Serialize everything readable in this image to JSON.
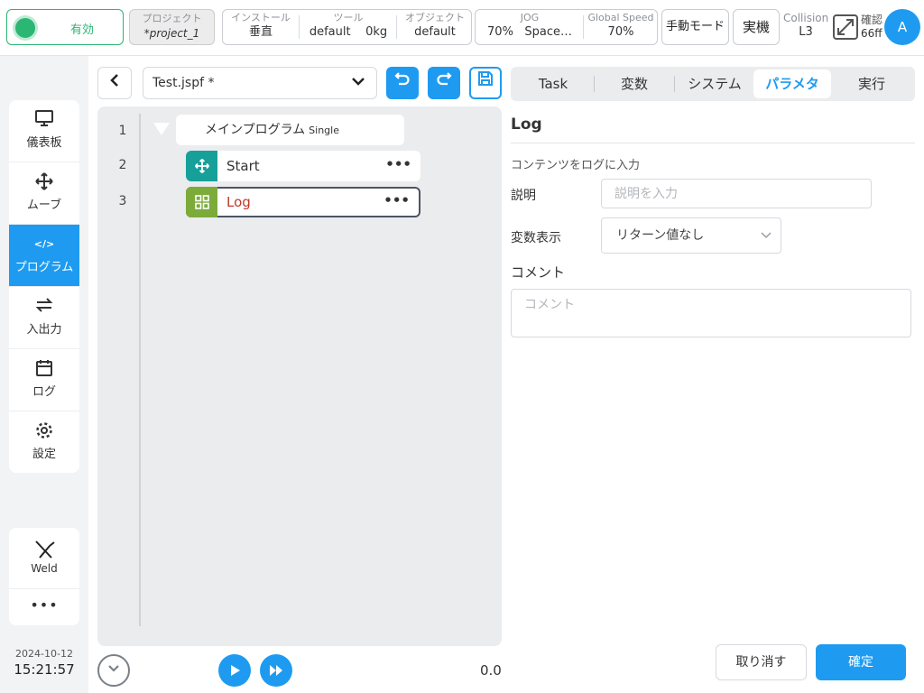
{
  "topbar": {
    "enable_label": "有効",
    "project": {
      "label": "プロジェクト",
      "value": "*project_1"
    },
    "install": {
      "label": "インストール",
      "value": "垂直"
    },
    "tool": {
      "label": "ツール",
      "value": "default",
      "extra": "0kg"
    },
    "object": {
      "label": "オブジェクト",
      "value": "default"
    },
    "jog": {
      "label": "JOG",
      "value": "70%",
      "extra": "Space…"
    },
    "global_speed": {
      "label": "Global Speed",
      "value": "70%"
    },
    "manual_mode": "手動モード",
    "real_machine": "実機",
    "collision": {
      "label": "Collision",
      "value": "L3"
    },
    "confirm": {
      "label": "確認",
      "value": "66ff"
    },
    "avatar": "A"
  },
  "sidebar": {
    "items": [
      {
        "label": "儀表板",
        "icon": "monitor-icon"
      },
      {
        "label": "ムーブ",
        "icon": "move-icon"
      },
      {
        "label": "プログラム",
        "icon": "code-icon"
      },
      {
        "label": "入出力",
        "icon": "swap-icon"
      },
      {
        "label": "ログ",
        "icon": "calendar-icon"
      },
      {
        "label": "設定",
        "icon": "gear-icon"
      }
    ],
    "weld_label": "Weld",
    "more_label": "•••",
    "date": "2024-10-12",
    "time": "15:21:57"
  },
  "editor": {
    "file_name": "Test.jspf *",
    "line_numbers": [
      "1",
      "2",
      "3"
    ],
    "main_program": "メインプログラム",
    "main_program_mode": "Single",
    "nodes": [
      {
        "label": "Start",
        "color": "#17a09a",
        "icon": "move-icon"
      },
      {
        "label": "Log",
        "color": "#7cab3a",
        "icon": "grid-icon"
      }
    ],
    "speed": "0.0"
  },
  "panel": {
    "tabs": [
      "Task",
      "変数",
      "システム",
      "パラメタ",
      "実行"
    ],
    "active_tab": "パラメタ",
    "title": "Log",
    "description": "コンテンツをログに入力",
    "desc_label": "説明",
    "desc_placeholder": "説明を入力",
    "var_label": "変数表示",
    "var_value": "リターン値なし",
    "comment_label": "コメント",
    "comment_placeholder": "コメント",
    "cancel": "取り消す",
    "ok": "確定"
  },
  "colors": {
    "accent": "#1e9bf0",
    "enabled": "#2bb673",
    "log_text": "#c0392b"
  }
}
